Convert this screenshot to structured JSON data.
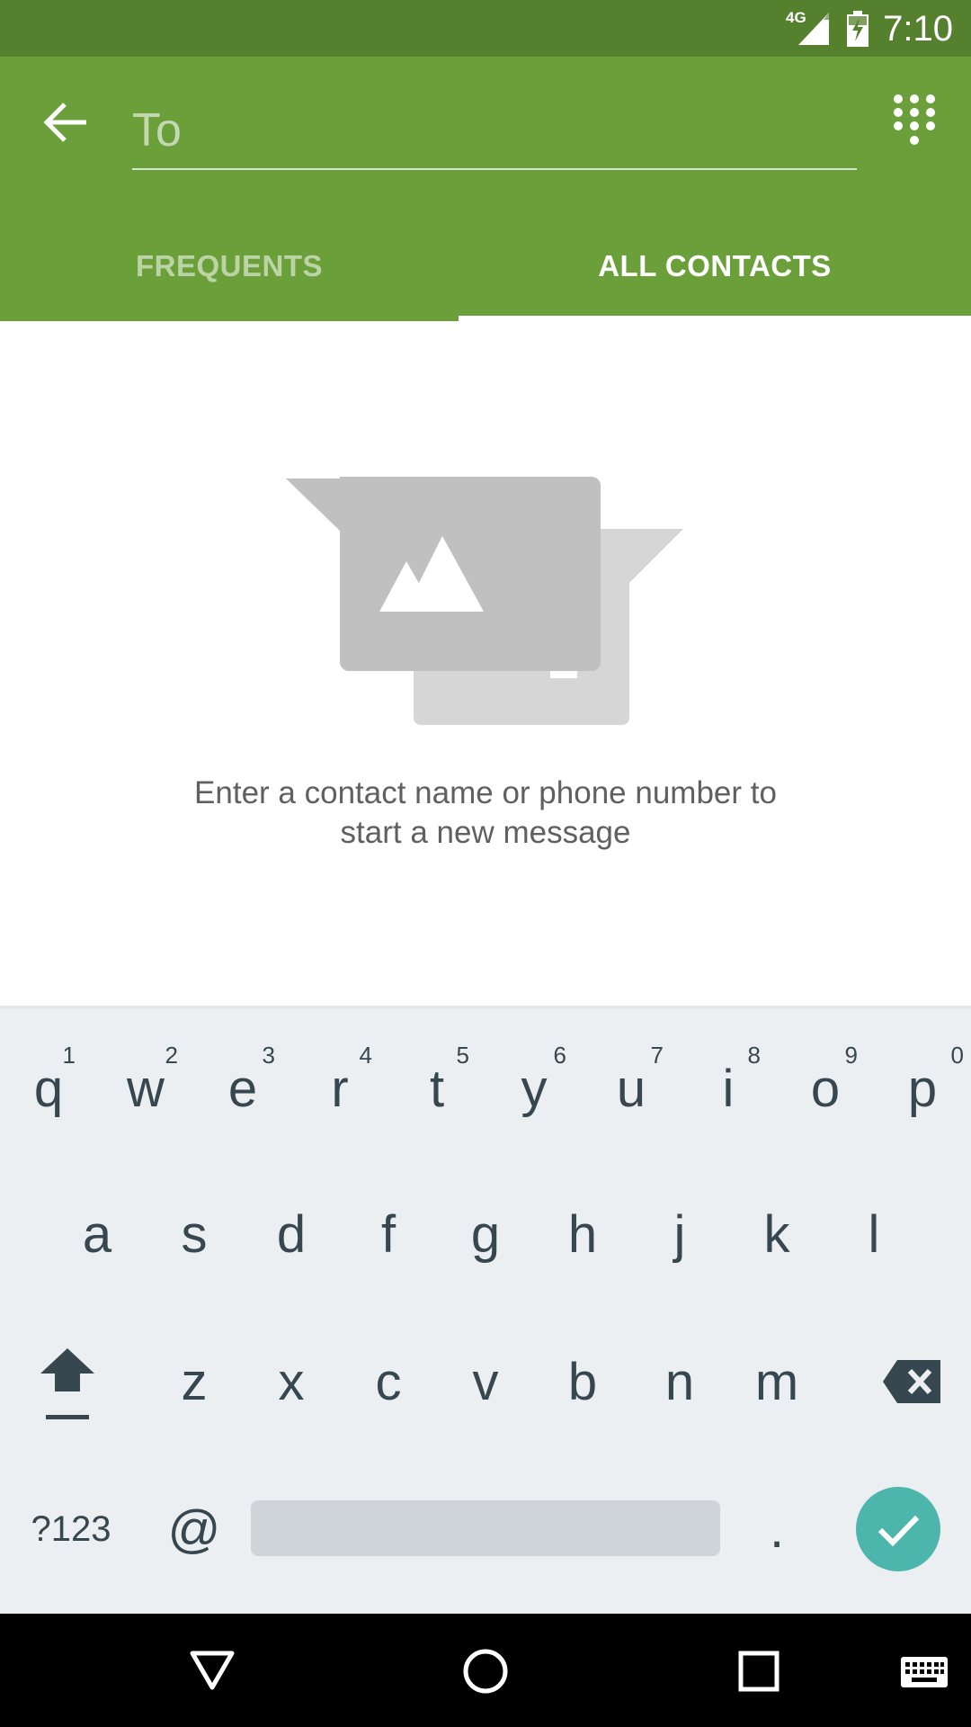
{
  "status_bar": {
    "time": "7:10",
    "network": "4G"
  },
  "header": {
    "to_placeholder": "To",
    "tabs": [
      {
        "label": "FREQUENTS",
        "selected": false
      },
      {
        "label": "ALL CONTACTS",
        "selected": true
      }
    ]
  },
  "empty_state": {
    "line1": "Enter a contact name or phone number to",
    "line2": "start a new message"
  },
  "keyboard": {
    "row1": [
      "q",
      "w",
      "e",
      "r",
      "t",
      "y",
      "u",
      "i",
      "o",
      "p"
    ],
    "row1_hints": [
      "1",
      "2",
      "3",
      "4",
      "5",
      "6",
      "7",
      "8",
      "9",
      "0"
    ],
    "row2": [
      "a",
      "s",
      "d",
      "f",
      "g",
      "h",
      "j",
      "k",
      "l"
    ],
    "row3": [
      "z",
      "x",
      "c",
      "v",
      "b",
      "n",
      "m"
    ],
    "symbols_label": "?123",
    "at_label": "@",
    "period_label": "."
  },
  "colors": {
    "status_bar": "#55802e",
    "app_bar": "#6a9f39",
    "keyboard_bg": "#eceff1",
    "enter_key": "#4db6ac"
  },
  "icons": {
    "back": "arrow-left-icon",
    "dialpad": "dialpad-icon",
    "shift": "shift-icon",
    "backspace": "backspace-icon",
    "enter": "checkmark-icon",
    "nav_back": "triangle-back-icon",
    "nav_home": "circle-home-icon",
    "nav_recents": "square-recents-icon",
    "keyboard_switch": "keyboard-icon"
  }
}
